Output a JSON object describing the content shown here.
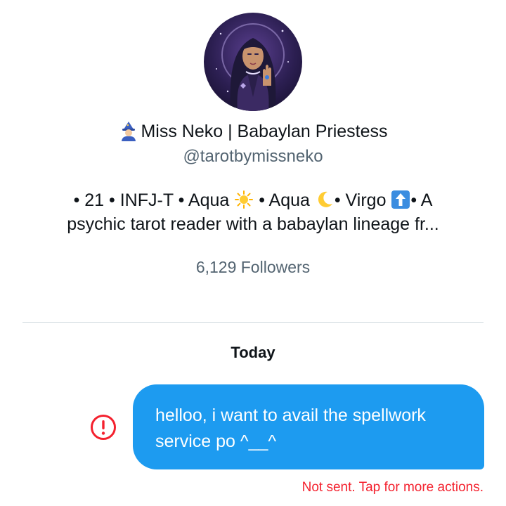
{
  "profile": {
    "display_name": "Miss Neko | Babaylan Priestess",
    "handle": "@tarotbymissneko",
    "bio_line1_part1": "• 21 • INFJ-T • Aqua",
    "bio_line1_part2": " • Aqua",
    "bio_line1_part3": "• Virgo",
    "bio_line1_part4": "• A",
    "bio_line2": "psychic tarot reader with a babaylan lineage fr...",
    "followers": "6,129 Followers"
  },
  "icons": {
    "name_emoji": "mage-emoji-icon",
    "sun": "sun-emoji-icon",
    "moon": "crescent-moon-emoji-icon",
    "rising": "up-arrow-emoji-icon",
    "error": "exclamation-circle-icon"
  },
  "conversation": {
    "date_separator": "Today",
    "message_text_line1": "helloo, i want to avail the spellwork",
    "message_text_line2": "service po ^__^",
    "status": "Not sent. Tap for more actions."
  },
  "colors": {
    "bubble": "#1d9bf0",
    "error": "#f4212e",
    "secondary_text": "#536471",
    "divider": "#cfd9de"
  }
}
